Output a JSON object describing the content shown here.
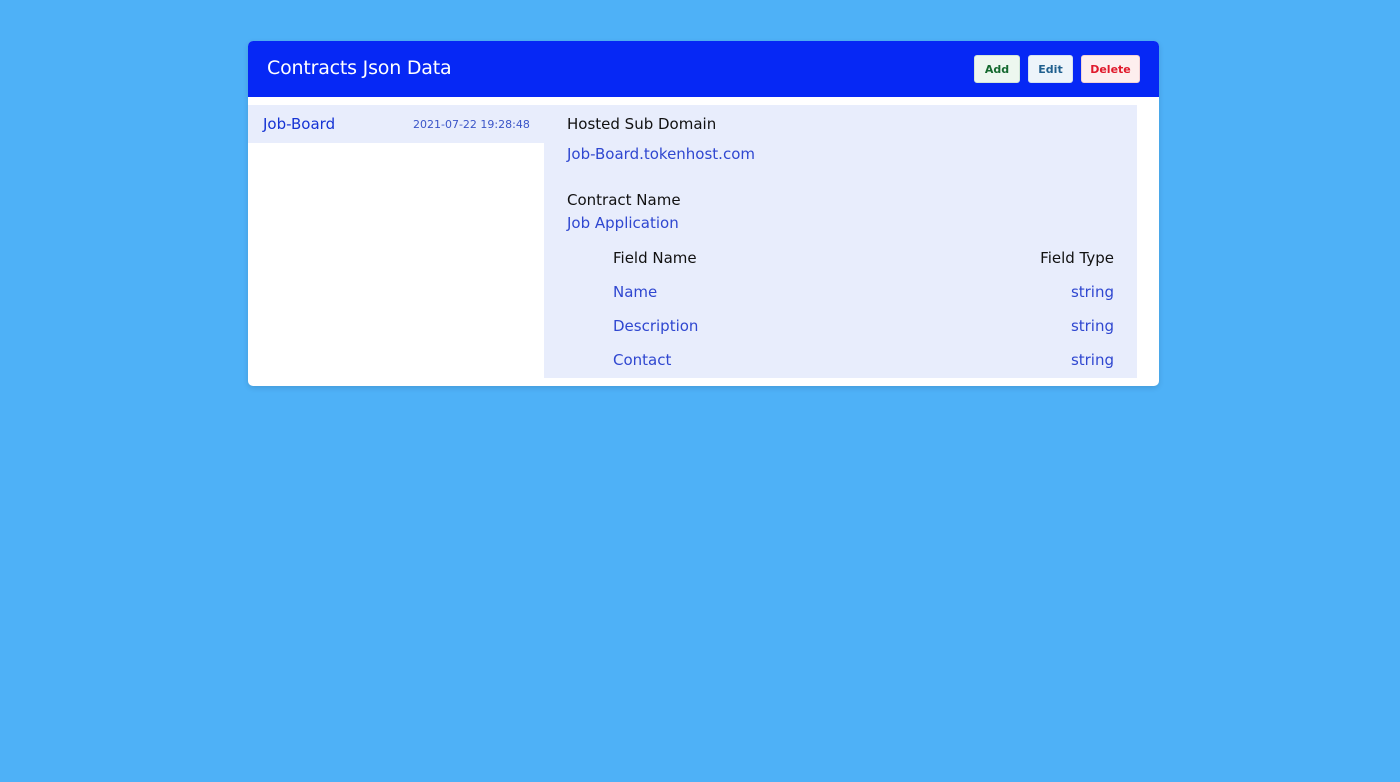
{
  "header": {
    "title": "Contracts Json Data",
    "add_label": "Add",
    "edit_label": "Edit",
    "delete_label": "Delete"
  },
  "list": {
    "items": [
      {
        "name": "Job-Board",
        "date": "2021-07-22 19:28:48"
      }
    ]
  },
  "detail": {
    "hosted_sub_domain_label": "Hosted Sub Domain",
    "hosted_sub_domain_value": "Job-Board.tokenhost.com",
    "contract_name_label": "Contract Name",
    "contract_name_value": "Job Application",
    "fields_header": {
      "name": "Field Name",
      "type": "Field Type"
    },
    "fields": [
      {
        "name": "Name",
        "type": "string"
      },
      {
        "name": "Description",
        "type": "string"
      },
      {
        "name": "Contact",
        "type": "string"
      }
    ]
  },
  "colors": {
    "background": "#4eb1f7",
    "header": "#0628f5",
    "panel": "#e8edfc",
    "link": "#2f47d0"
  }
}
